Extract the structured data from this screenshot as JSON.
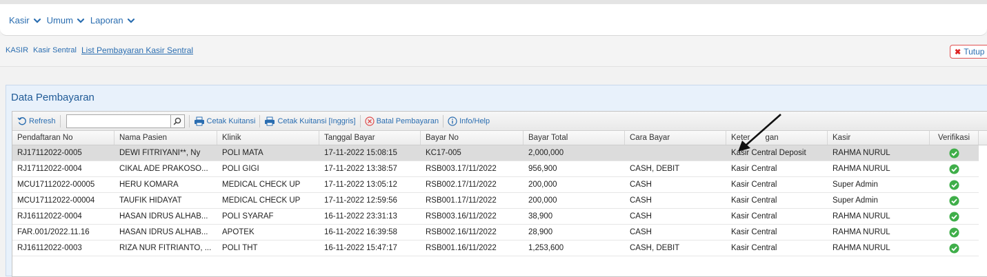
{
  "menu": [
    {
      "label": "Kasir"
    },
    {
      "label": "Umum"
    },
    {
      "label": "Laporan"
    }
  ],
  "breadcrumb": [
    "KASIR",
    "Kasir Sentral",
    "List Pembayaran Kasir Sentral"
  ],
  "close_button": {
    "label": "Tutup"
  },
  "panel": {
    "title": "Data Pembayaran"
  },
  "toolbar": {
    "refresh": "Refresh",
    "search_value": "",
    "cetak_kuitansi": "Cetak Kuitansi",
    "cetak_kuitansi_inggris": "Cetak Kuitansi [Inggris]",
    "batal_pembayaran": "Batal Pembayaran",
    "info_help": "Info/Help"
  },
  "columns": [
    "Pendaftaran No",
    "Nama Pasien",
    "Klinik",
    "Tanggal Bayar",
    "Bayar No",
    "Bayar Total",
    "Cara Bayar",
    "Keterangan",
    "Kasir",
    "Verifikasi"
  ],
  "header_keterangan_visible": [
    "Keter",
    "gan"
  ],
  "rows": [
    [
      "RJ17112022-0005",
      "DEWI FITRIYANI**, Ny",
      "POLI MATA",
      "17-11-2022 15:08:15",
      "KC17-005",
      "2,000,000",
      "",
      "Kasir Central Deposit",
      "RAHMA NURUL"
    ],
    [
      "RJ17112022-0004",
      "CIKAL ADE PRAKOSO...",
      "POLI GIGI",
      "17-11-2022 13:38:57",
      "RSB003.17/11/2022",
      "956,900",
      "CASH, DEBIT",
      "Kasir Central",
      "RAHMA NURUL"
    ],
    [
      "MCU17112022-00005",
      "HERU KOMARA",
      "MEDICAL CHECK UP",
      "17-11-2022 13:05:12",
      "RSB002.17/11/2022",
      "200,000",
      "CASH",
      "Kasir Central",
      "Super Admin"
    ],
    [
      "MCU17112022-00004",
      "TAUFIK HIDAYAT",
      "MEDICAL CHECK UP",
      "17-11-2022 12:59:56",
      "RSB001.17/11/2022",
      "200,000",
      "CASH",
      "Kasir Central",
      "Super Admin"
    ],
    [
      "RJ16112022-0004",
      "HASAN IDRUS ALHAB...",
      "POLI SYARAF",
      "16-11-2022 23:31:13",
      "RSB003.16/11/2022",
      "38,900",
      "CASH",
      "Kasir Central",
      "RAHMA NURUL"
    ],
    [
      "FAR.001/2022.11.16",
      "HASAN IDRUS ALHAB...",
      "APOTEK",
      "16-11-2022 16:39:58",
      "RSB002.16/11/2022",
      "28,900",
      "CASH",
      "Kasir Central",
      "RAHMA NURUL"
    ],
    [
      "RJ16112022-0003",
      "RIZA NUR FITRIANTO, ...",
      "POLI THT",
      "16-11-2022 15:47:17",
      "RSB001.16/11/2022",
      "1,253,600",
      "CASH, DEBIT",
      "Kasir Central",
      "RAHMA NURUL"
    ]
  ],
  "colors": {
    "link": "#2a6db0",
    "check": "#3fae49",
    "close_border": "#e05050"
  }
}
